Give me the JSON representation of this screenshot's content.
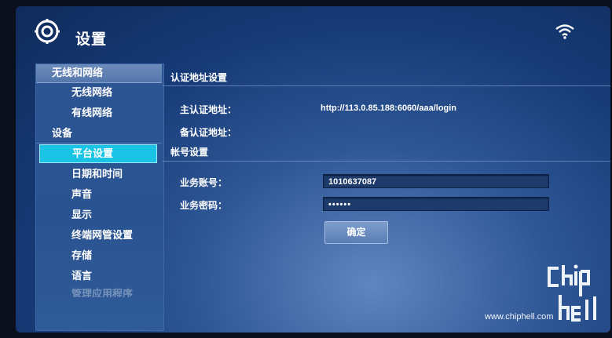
{
  "header": {
    "title": "设置"
  },
  "sidebar": {
    "items": [
      {
        "label": "无线和网络",
        "kind": "head",
        "state": "active"
      },
      {
        "label": "无线网络",
        "kind": "sub"
      },
      {
        "label": "有线网络",
        "kind": "sub"
      },
      {
        "label": "设备",
        "kind": "head",
        "state": "plain"
      },
      {
        "label": "平台设置",
        "kind": "sub",
        "state": "selected"
      },
      {
        "label": "日期和时间",
        "kind": "sub"
      },
      {
        "label": "声音",
        "kind": "sub"
      },
      {
        "label": "显示",
        "kind": "sub"
      },
      {
        "label": "终端网管设置",
        "kind": "sub"
      },
      {
        "label": "存储",
        "kind": "sub"
      },
      {
        "label": "语言",
        "kind": "sub"
      },
      {
        "label": "管理应用程序",
        "kind": "sub",
        "state": "faded"
      }
    ]
  },
  "auth_section": {
    "title": "认证地址设置",
    "primary_label": "主认证地址：",
    "primary_value": "http://113.0.85.188:6060/aaa/login",
    "backup_label": "备认证地址："
  },
  "account_section": {
    "title": "帐号设置",
    "account_label": "业务账号：",
    "account_value": "1010637087",
    "password_label": "业务密码：",
    "password_value": "••••••",
    "confirm_label": "确定"
  },
  "watermark": {
    "url": "www.chiphell.com"
  },
  "colors": {
    "background": "#173b77",
    "sidebar": "#2c5593",
    "selected": "#19c4e4",
    "field": "#1d3a6a"
  },
  "icons": {
    "settings": "gear-icon",
    "network": "wifi-icon"
  }
}
